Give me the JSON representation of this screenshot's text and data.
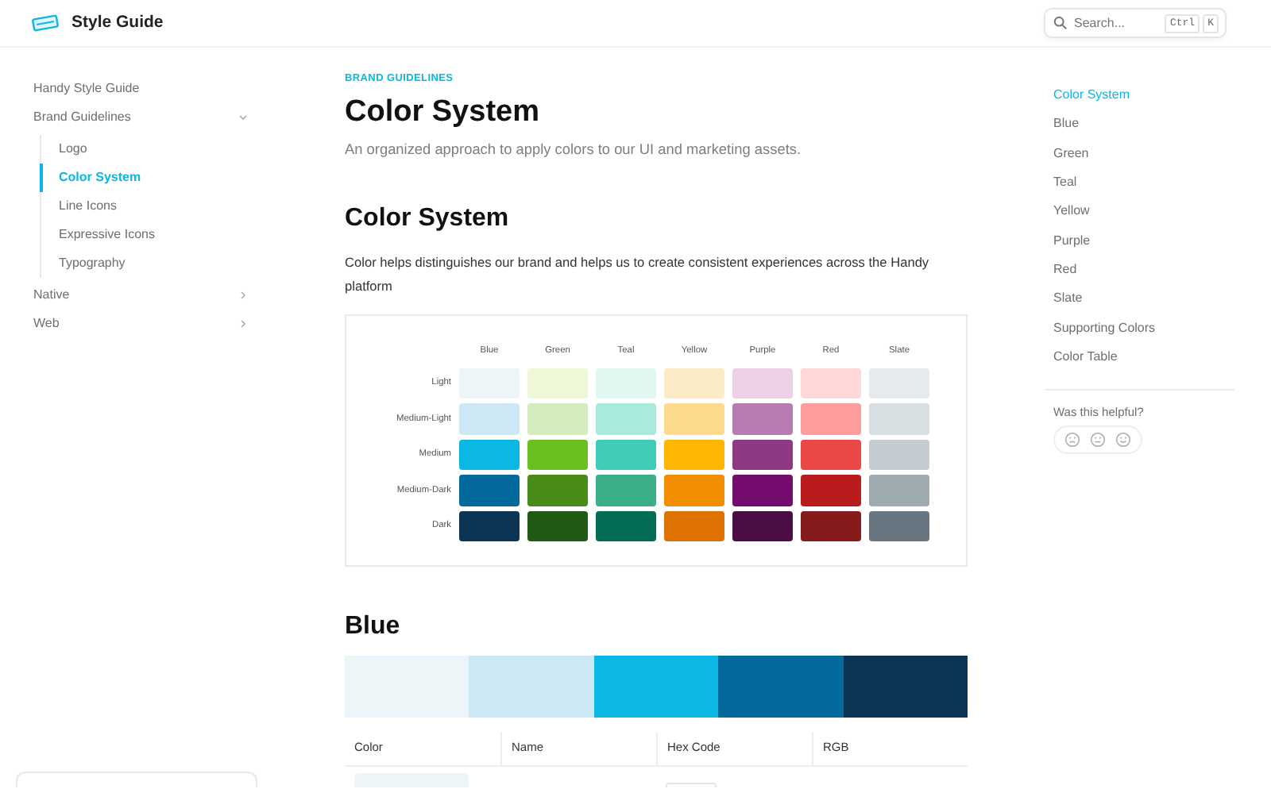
{
  "header": {
    "title": "Style Guide",
    "search": {
      "placeholder": "Search...",
      "keys": [
        "Ctrl",
        "K"
      ]
    }
  },
  "sidebar": {
    "items": [
      {
        "label": "Handy Style Guide",
        "selected": false
      },
      {
        "label": "Brand Guidelines",
        "selected": false,
        "expanded": true,
        "children": [
          {
            "label": "Logo",
            "selected": false
          },
          {
            "label": "Color System",
            "selected": true
          },
          {
            "label": "Line Icons",
            "selected": false
          },
          {
            "label": "Expressive Icons",
            "selected": false
          },
          {
            "label": "Typography",
            "selected": false
          }
        ]
      },
      {
        "label": "Native",
        "selected": false,
        "expanded": false
      },
      {
        "label": "Web",
        "selected": false,
        "expanded": false
      }
    ]
  },
  "page": {
    "breadcrumb": "BRAND GUIDELINES",
    "title": "Color System",
    "subtitle": "An organized approach to apply colors to our UI and marketing assets.",
    "section_title": "Color System",
    "section_text": "Color helps distinguishes our brand and helps us to create consistent experiences across the Handy platform",
    "color_grid": {
      "columns": [
        "Blue",
        "Green",
        "Teal",
        "Yellow",
        "Purple",
        "Red",
        "Slate"
      ],
      "rows": [
        {
          "label": "Light",
          "swatches": [
            {
              "color": "#edf5f8"
            },
            {
              "color": "#eef8d9"
            },
            {
              "color": "#e1f7f1"
            },
            {
              "color": "#fcebc7"
            },
            {
              "color": "#ecd1e9"
            },
            {
              "color": "#fed7d8"
            },
            {
              "color": "#e6eaec"
            }
          ]
        },
        {
          "label": "Medium-Light",
          "swatches": [
            {
              "color": "#cde8f5"
            },
            {
              "color": "#d4ebbe"
            },
            {
              "color": "#a8eadb"
            },
            {
              "color": "#fcd98d"
            },
            {
              "color": "#b77db0"
            },
            {
              "color": "#fc9c9c"
            },
            {
              "color": "#d8e0e3"
            }
          ]
        },
        {
          "label": "Medium",
          "swatches": [
            {
              "color": "#0bb8e3"
            },
            {
              "color": "#6bbf21"
            },
            {
              "color": "#3ecdb4"
            },
            {
              "color": "#feb602"
            },
            {
              "color": "#8e3785"
            },
            {
              "color": "#ea4749"
            },
            {
              "color": "#c3cdd1"
            }
          ]
        },
        {
          "label": "Medium-Dark",
          "swatches": [
            {
              "color": "#036a9e"
            },
            {
              "color": "#4a8c1a"
            },
            {
              "color": "#3aaf87"
            },
            {
              "color": "#f18f00"
            },
            {
              "color": "#730c6c"
            },
            {
              "color": "#b91c1c"
            },
            {
              "color": "#9eabb1"
            }
          ]
        },
        {
          "label": "Dark",
          "swatches": [
            {
              "color": "#0b3455"
            },
            {
              "color": "#215a15"
            },
            {
              "color": "#046b55"
            },
            {
              "color": "#de7302"
            },
            {
              "color": "#4b0d45"
            },
            {
              "color": "#861b1b"
            },
            {
              "color": "#677681"
            }
          ]
        }
      ]
    },
    "blue": {
      "title": "Blue",
      "bar": [
        {
          "color": "#edf5f8"
        },
        {
          "color": "#cde8f5"
        },
        {
          "color": "#0bb8e3"
        },
        {
          "color": "#036a9e"
        },
        {
          "color": "#0b3455"
        }
      ],
      "table": {
        "columns": [
          "Color",
          "Name",
          "Hex Code",
          "RGB"
        ],
        "rows": [
          {
            "color": "#edf5f8"
          }
        ]
      }
    }
  },
  "toc": {
    "items": [
      {
        "label": "Color System",
        "selected": true
      },
      {
        "label": "Blue",
        "selected": false
      },
      {
        "label": "Green",
        "selected": false
      },
      {
        "label": "Teal",
        "selected": false
      },
      {
        "label": "Yellow",
        "selected": false
      },
      {
        "label": "Purple",
        "selected": false
      },
      {
        "label": "Red",
        "selected": false
      },
      {
        "label": "Slate",
        "selected": false
      },
      {
        "label": "Supporting Colors",
        "selected": false
      },
      {
        "label": "Color Table",
        "selected": false
      }
    ],
    "feedback": {
      "question": "Was this helpful?",
      "options": [
        {
          "kind": "sad"
        },
        {
          "kind": "neutral"
        },
        {
          "kind": "happy"
        }
      ]
    }
  }
}
